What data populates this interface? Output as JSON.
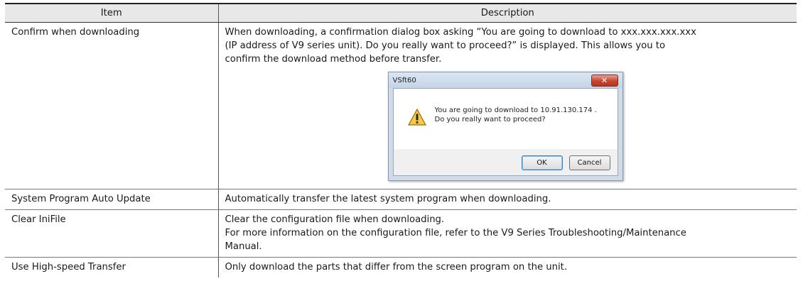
{
  "table": {
    "header_item": "Item",
    "header_description": "Description",
    "rows": [
      {
        "item": "Confirm when downloading",
        "description": [
          "When downloading, a confirmation dialog box asking “You are going to download to xxx.xxx.xxx.xxx",
          "(IP address of V9 series unit). Do you really want to proceed?” is displayed. This allows you to",
          "confirm the download method before transfer."
        ]
      },
      {
        "item": "System Program Auto Update",
        "description": [
          "Automatically transfer the latest system program when downloading."
        ]
      },
      {
        "item": "Clear IniFile",
        "description": [
          "Clear the configuration file when downloading.",
          "For more information on the configuration file, refer to the V9 Series Troubleshooting/Maintenance",
          "Manual."
        ]
      },
      {
        "item": "Use High-speed Transfer",
        "description": [
          "Only download the parts that differ from the screen program on the unit."
        ]
      }
    ]
  },
  "dialog": {
    "title": "VSft60",
    "close_glyph": "✕",
    "message_line1": "You are going to download to  10.91.130.174  .",
    "message_line2": "Do you really want to proceed?",
    "icon": "warning-icon",
    "ok_label": "OK",
    "cancel_label": "Cancel"
  }
}
